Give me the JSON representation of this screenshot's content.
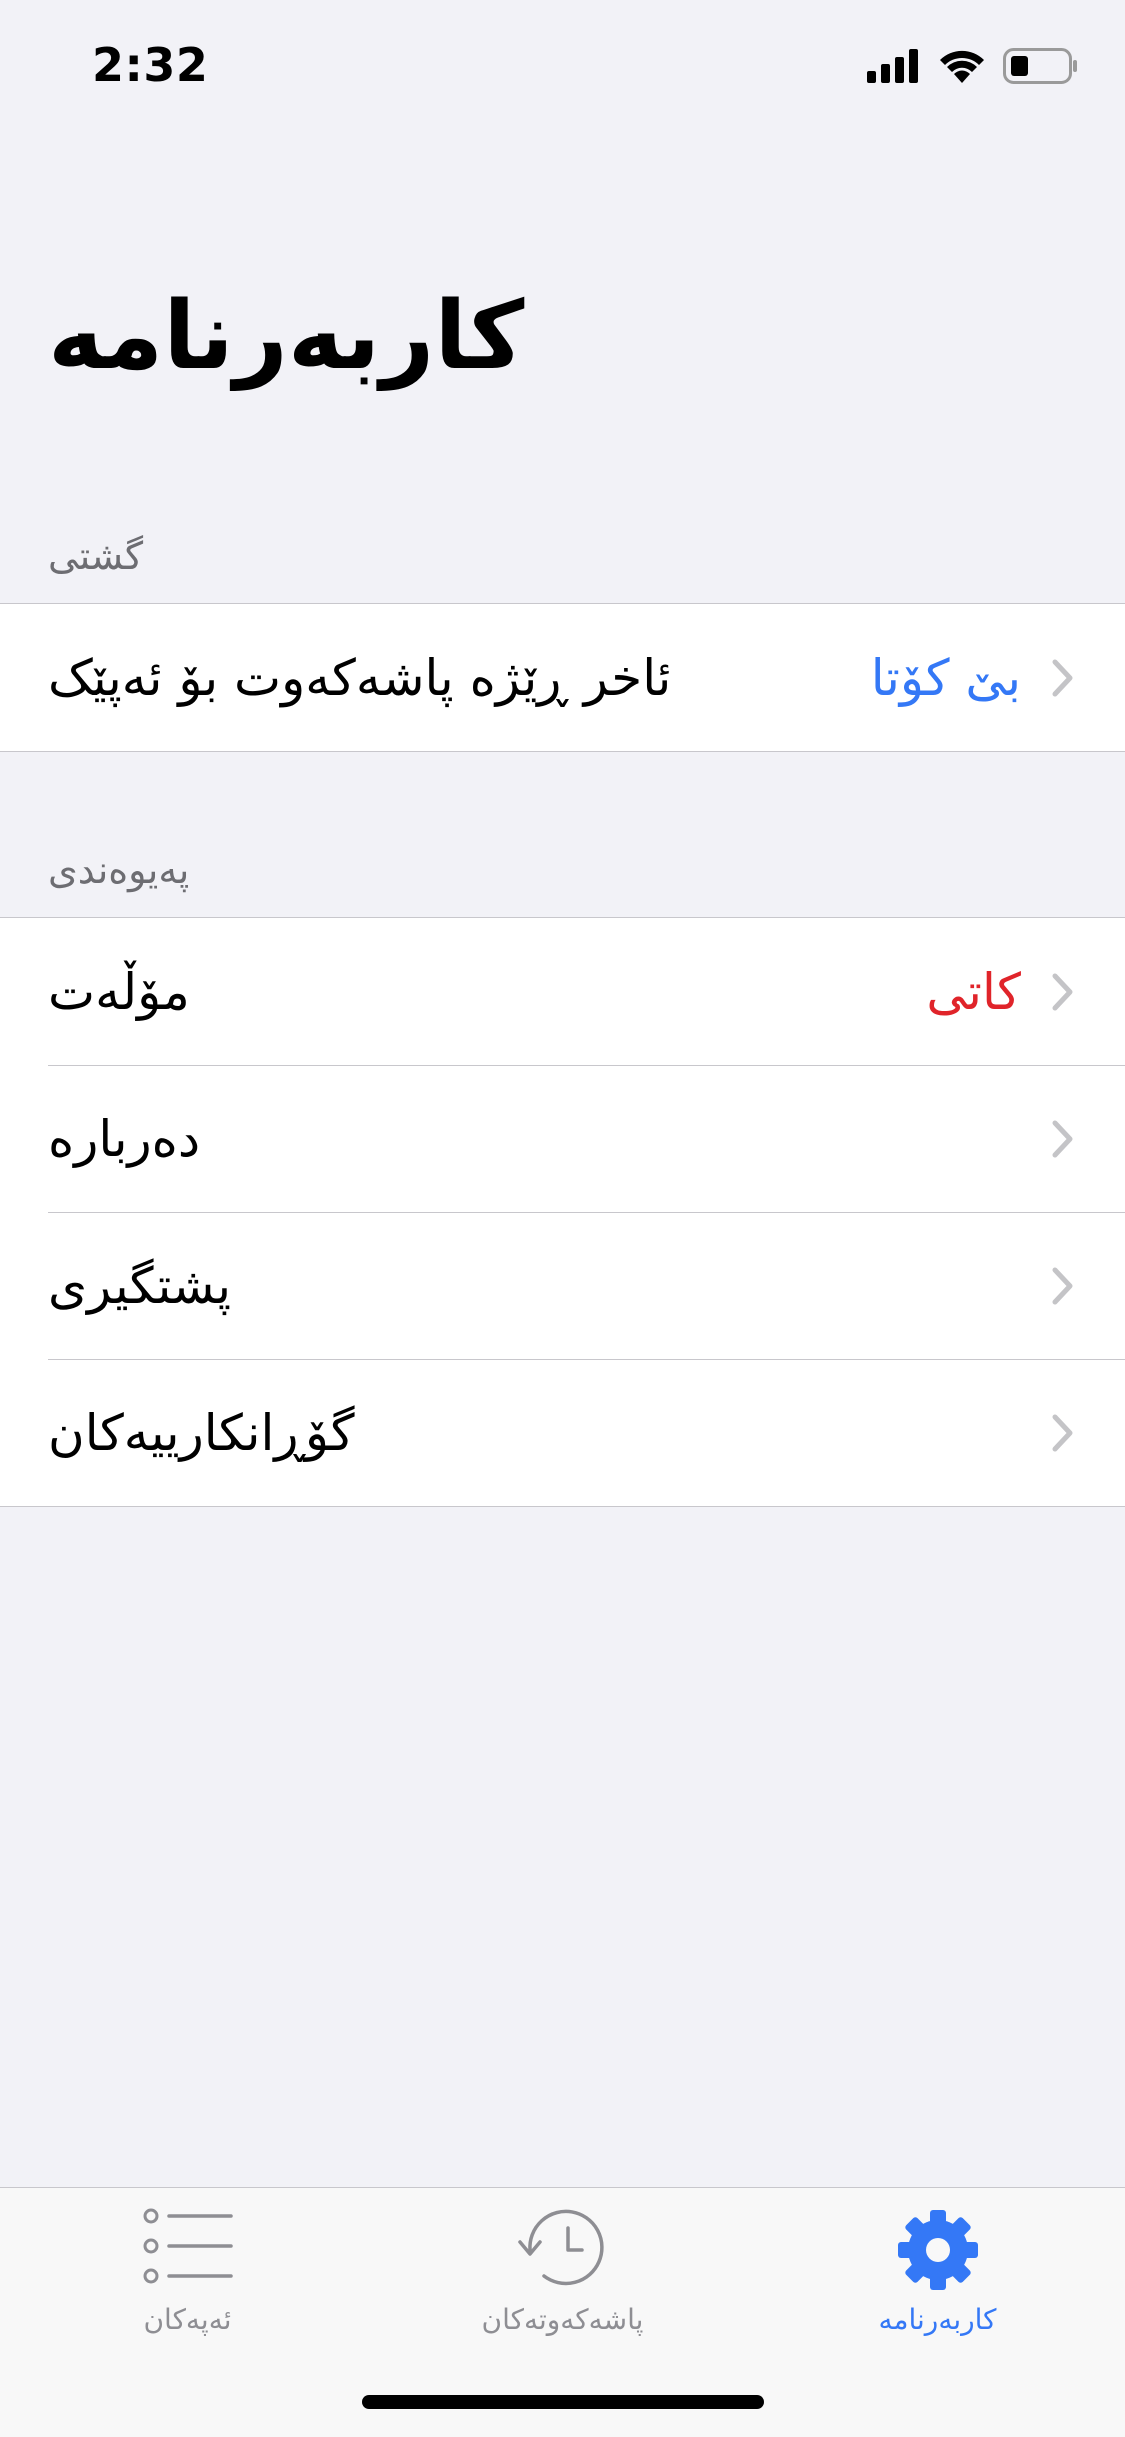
{
  "status_bar": {
    "time": "2:32"
  },
  "page_title": "کاربەرنامە",
  "sections": {
    "general": {
      "header": "گشتی",
      "rows": [
        {
          "label": "ئاخر ڕێژە پاشەکەوت بۆ ئەپێک",
          "value": "بێ کۆتا"
        }
      ]
    },
    "relations": {
      "header": "پەیوەندی",
      "rows": [
        {
          "label": "مۆڵەت",
          "value": "کاتی"
        },
        {
          "label": "دەربارە",
          "value": ""
        },
        {
          "label": "پشتگیری",
          "value": ""
        },
        {
          "label": "گۆڕانکارییەکان",
          "value": ""
        }
      ]
    }
  },
  "tab_bar": {
    "tabs": [
      {
        "label": "ئەپەکان",
        "icon": "list-icon",
        "selected": false
      },
      {
        "label": "پاشەکەوتەکان",
        "icon": "history-clock-icon",
        "selected": false
      },
      {
        "label": "کاربەرنامە",
        "icon": "gear-icon",
        "selected": true
      }
    ]
  },
  "colors": {
    "accent_blue": "#3478f6",
    "status_red": "#e0242a",
    "inactive_gray": "#8e8e93",
    "background": "#f2f2f7"
  }
}
